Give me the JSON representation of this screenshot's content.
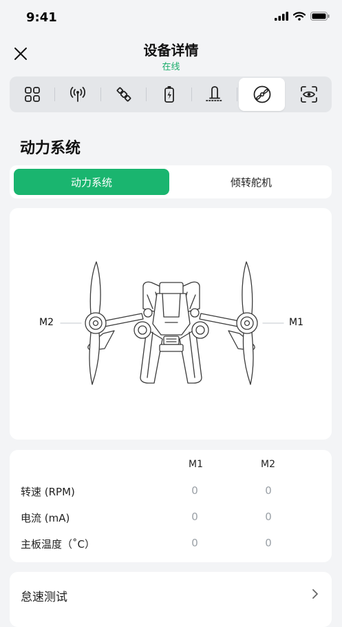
{
  "status_bar": {
    "time": "9:41"
  },
  "header": {
    "title": "设备详情",
    "status": "在线",
    "status_color": "#1aad6b"
  },
  "tabs": [
    {
      "icon": "grid-icon"
    },
    {
      "icon": "signal-icon"
    },
    {
      "icon": "satellite-icon"
    },
    {
      "icon": "battery-icon"
    },
    {
      "icon": "beacon-icon"
    },
    {
      "icon": "propeller-icon",
      "active": true
    },
    {
      "icon": "vision-icon"
    }
  ],
  "section": {
    "title": "动力系统"
  },
  "segment": {
    "active_label": "动力系统",
    "inactive_label": "倾转舵机"
  },
  "drone": {
    "left_motor": "M2",
    "right_motor": "M1"
  },
  "table": {
    "headers": [
      "M1",
      "M2"
    ],
    "rows": [
      {
        "label": "转速 (RPM)",
        "m1": "0",
        "m2": "0"
      },
      {
        "label": "电流 (mA)",
        "m1": "0",
        "m2": "0"
      },
      {
        "label": "主板温度（˚C）",
        "m1": "0",
        "m2": "0"
      }
    ]
  },
  "quick_test": {
    "label": "怠速测试"
  },
  "colors": {
    "accent": "#1ab56f",
    "background": "#f3f4f6"
  }
}
